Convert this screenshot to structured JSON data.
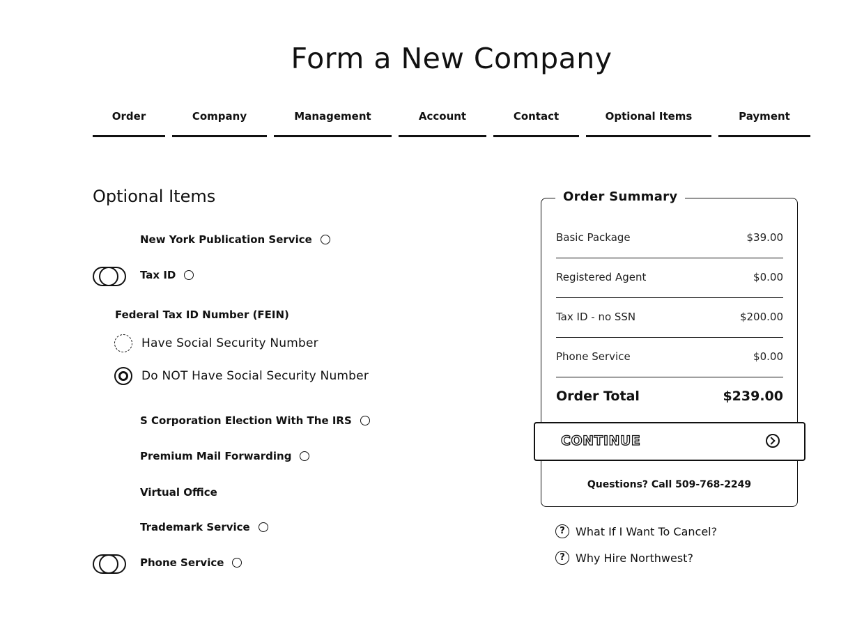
{
  "page": {
    "title": "Form a New Company"
  },
  "steps": [
    {
      "label": "Order"
    },
    {
      "label": "Company"
    },
    {
      "label": "Management"
    },
    {
      "label": "Account"
    },
    {
      "label": "Contact"
    },
    {
      "label": "Optional Items"
    },
    {
      "label": "Payment"
    }
  ],
  "optional_items": {
    "section_title": "Optional Items",
    "items": [
      {
        "label": "New York Publication Service",
        "toggle_on": false,
        "has_info_icon": true
      },
      {
        "label": "Tax ID",
        "toggle_on": true,
        "has_info_icon": true
      },
      {
        "label": "S Corporation Election With The IRS",
        "toggle_on": false,
        "has_info_icon": true
      },
      {
        "label": "Premium Mail Forwarding",
        "toggle_on": false,
        "has_info_icon": true
      },
      {
        "label": "Virtual Office",
        "toggle_on": false,
        "has_info_icon": false
      },
      {
        "label": "Trademark Service",
        "toggle_on": false,
        "has_info_icon": true
      },
      {
        "label": "Phone Service",
        "toggle_on": true,
        "has_info_icon": true
      }
    ],
    "fein": {
      "label": "Federal Tax ID Number (FEIN)",
      "options": [
        {
          "label": "Have Social Security Number",
          "selected": false
        },
        {
          "label": "Do NOT Have Social Security Number",
          "selected": true
        }
      ]
    }
  },
  "summary": {
    "title": "Order Summary",
    "lines": [
      {
        "label": "Basic Package",
        "amount": "$39.00"
      },
      {
        "label": "Registered Agent",
        "amount": "$0.00"
      },
      {
        "label": "Tax ID - no SSN",
        "amount": "$200.00"
      },
      {
        "label": "Phone Service",
        "amount": "$0.00"
      }
    ],
    "total_label": "Order Total",
    "total_amount": "$239.00",
    "continue_label": "CONTINUE",
    "questions": "Questions? Call 509-768-2249"
  },
  "help_links": [
    {
      "icon": "question-icon",
      "label": "What If I Want To Cancel?"
    },
    {
      "icon": "question-icon",
      "label": "Why Hire Northwest?"
    }
  ]
}
